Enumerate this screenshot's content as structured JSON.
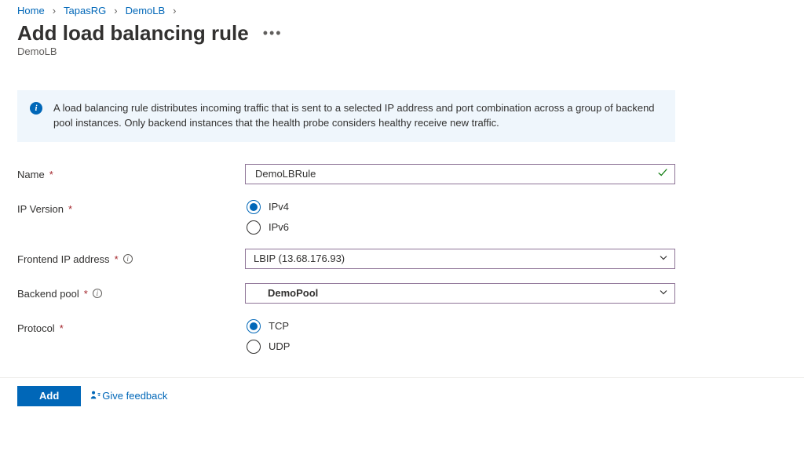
{
  "breadcrumb": {
    "home": "Home",
    "rg": "TapasRG",
    "resource": "DemoLB"
  },
  "title": "Add load balancing rule",
  "subtitle": "DemoLB",
  "info_text": "A load balancing rule distributes incoming traffic that is sent to a selected IP address and port combination across a group of backend pool instances. Only backend instances that the health probe considers healthy receive new traffic.",
  "fields": {
    "name": {
      "label": "Name",
      "value": "DemoLBRule"
    },
    "ip_version": {
      "label": "IP Version",
      "options": {
        "v4": "IPv4",
        "v6": "IPv6"
      },
      "selected": "v4"
    },
    "frontend_ip": {
      "label": "Frontend IP address",
      "value": "LBIP (13.68.176.93)"
    },
    "backend_pool": {
      "label": "Backend pool",
      "value": "DemoPool"
    },
    "protocol": {
      "label": "Protocol",
      "options": {
        "tcp": "TCP",
        "udp": "UDP"
      },
      "selected": "tcp"
    }
  },
  "footer": {
    "add": "Add",
    "feedback": "Give feedback"
  }
}
